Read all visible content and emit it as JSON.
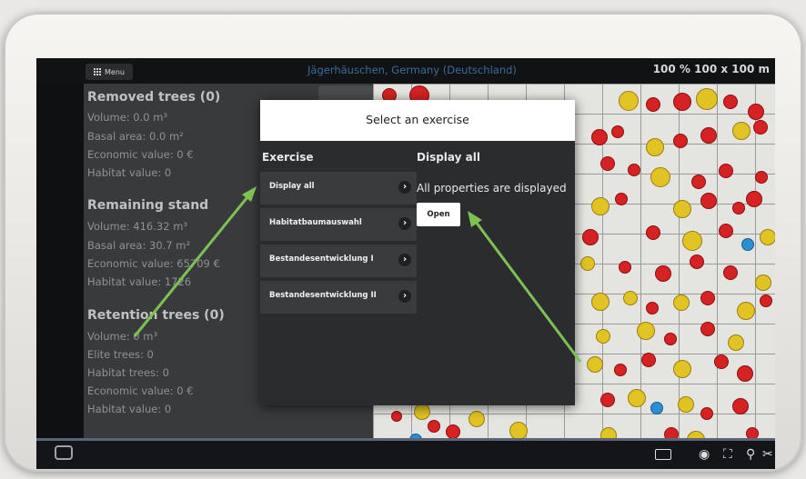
{
  "header": {
    "menu_label": "Menu",
    "location": "Jägerhäuschen, Germany (Deutschland)",
    "scale": "100 % 100 x 100 m"
  },
  "sidebar": {
    "removed": {
      "title": "Removed trees (0)",
      "volume": "Volume: 0.0 m³",
      "basal_area": "Basal area: 0.0 m²",
      "economic_value": "Economic value: 0 €",
      "habitat_value": "Habitat value: 0"
    },
    "remaining": {
      "title": "Remaining stand",
      "volume": "Volume: 416.32 m³",
      "basal_area": "Basal area: 30.7 m²",
      "economic_value": "Economic value: 65709 €",
      "habitat_value": "Habitat value: 1726"
    },
    "retention": {
      "title": "Retention trees (0)",
      "volume": "Volume: 0 m³",
      "elite_trees": "Elite trees: 0",
      "habitat_trees": "Habitat trees: 0",
      "economic_value": "Economic value: 0 €",
      "habitat_value": "Habitat value: 0"
    }
  },
  "dialog": {
    "title": "Select an exercise",
    "col_exercise": "Exercise",
    "col_detail": "Display all",
    "exercises": [
      {
        "label": "Display all"
      },
      {
        "label": "Habitatbaumauswahl"
      },
      {
        "label": "Bestandesentwicklung I"
      },
      {
        "label": "Bestandesentwicklung II"
      }
    ],
    "description": "All properties are displayed",
    "open_label": "Open"
  },
  "colors": {
    "tree_red": "#d62222",
    "tree_yellow": "#e2c324",
    "tree_blue": "#2b8fd4",
    "arrow_green": "#7dc251"
  },
  "navbar": {
    "icons": [
      "back-icon",
      "layers-icon",
      "eye-icon",
      "fullscreen-icon",
      "location-pin-icon",
      "scissors-icon"
    ]
  }
}
